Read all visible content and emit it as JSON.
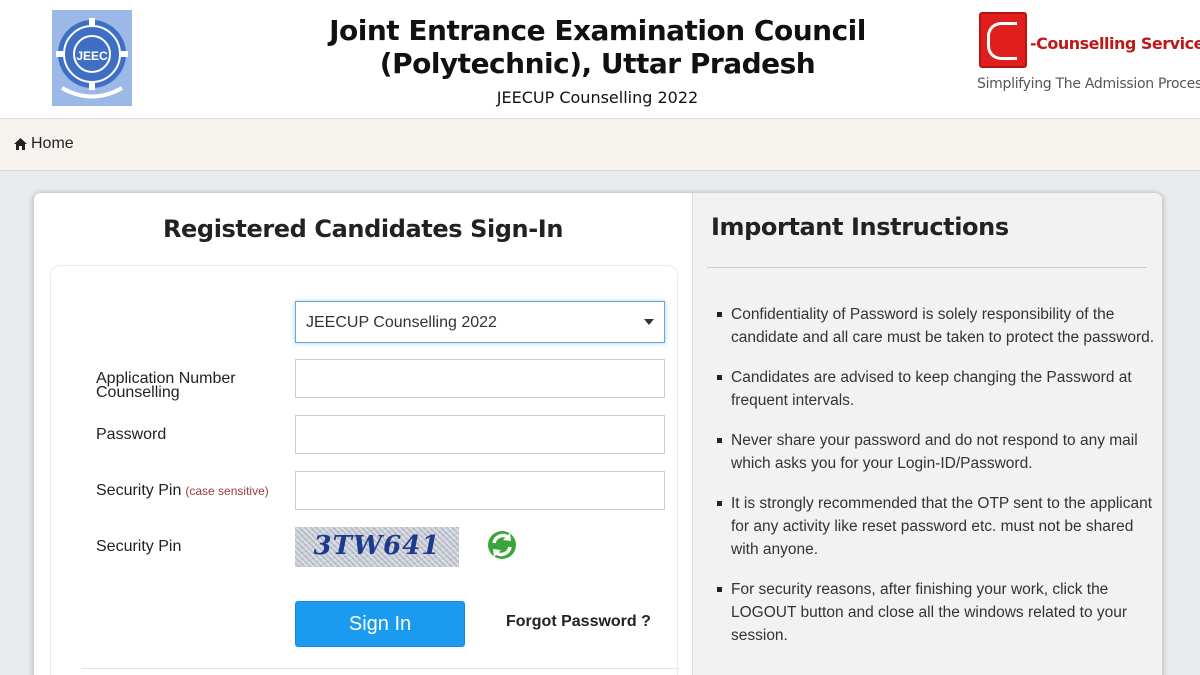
{
  "header": {
    "title_line1": "Joint Entrance Examination Council",
    "title_line2": "(Polytechnic), Uttar Pradesh",
    "subtitle": "JEECUP Counselling 2022",
    "left_logo_text": "JEEC",
    "right_logo": {
      "name": "-Counselling Services",
      "tagline": "Simplifying The Admission Process",
      "brand_color": "#e01e1e"
    }
  },
  "nav": {
    "home_label": "Home",
    "home_icon": "home-icon"
  },
  "signin": {
    "title": "Registered Candidates Sign-In",
    "counselling_label": "Counselling",
    "counselling_selected": "JEECUP Counselling 2022",
    "application_number_label": "Application Number",
    "application_number_value": "",
    "password_label": "Password",
    "password_value": "",
    "security_pin_label": "Security Pin",
    "security_pin_note": "(case sensitive)",
    "security_pin_value": "",
    "captcha_label": "Security Pin",
    "captcha_text": "3TW641",
    "refresh_icon": "refresh-icon",
    "signin_button": "Sign In",
    "forgot_password": "Forgot Password ?",
    "button_color": "#1a9bf0"
  },
  "instructions": {
    "title": "Important Instructions",
    "items": [
      "Confidentiality of Password is solely responsibility of the candidate and all care must be taken to protect the password.",
      "Candidates are advised to keep changing the Password at frequent intervals.",
      "Never share your password and do not respond to any mail which asks you for your Login-ID/Password.",
      "It is strongly recommended that the OTP sent to the applicant for any activity like reset password etc. must not be shared with anyone.",
      "For security reasons, after finishing your work, click the LOGOUT button and close all the windows related to your session."
    ]
  }
}
